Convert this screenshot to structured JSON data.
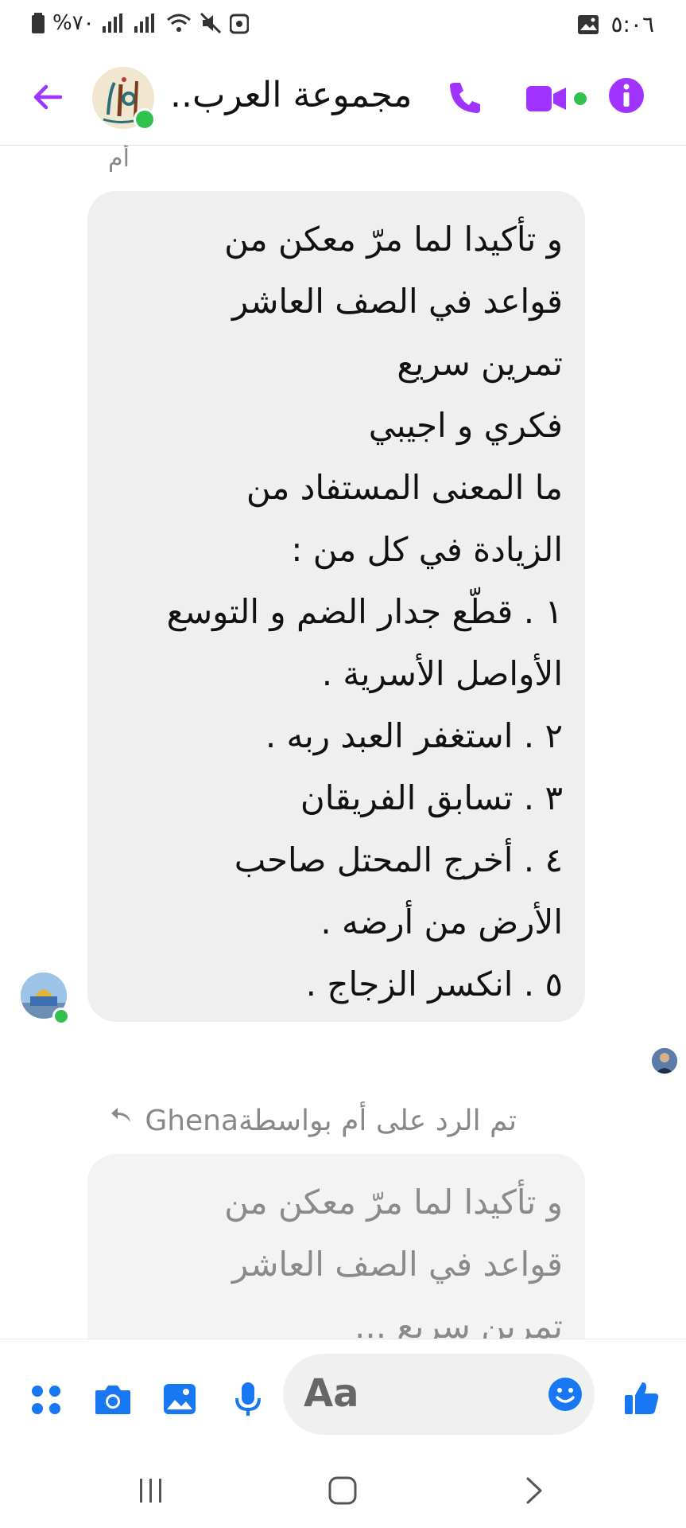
{
  "status_bar": {
    "battery": "%٧٠",
    "time": "٥:٠٦"
  },
  "header": {
    "title": "مجموعة العرب.."
  },
  "messages": [
    {
      "sender_label": "أم",
      "lines": [
        "و تأكيدا لما مرّ معكن من",
        "قواعد في الصف العاشر",
        "تمرين سريع",
        "فكري و اجيبي",
        "ما المعنى المستفاد من",
        "الزيادة في كل من :",
        "١ . قطّع جدار الضم و التوسع",
        "الأواصل الأسرية .",
        "٢ . استغفر العبد ربه .",
        "٣ . تسابق الفريقان",
        "٤ . أخرج المحتل صاحب",
        "الأرض من أرضه .",
        "٥ . انكسر الزجاج ."
      ]
    }
  ],
  "reply": {
    "note": "تم الرد على أم بواسطة",
    "by": "Ghena",
    "preview_lines": [
      "و تأكيدا لما مرّ معكن من",
      "قواعد في الصف العاشر",
      "تمرين سريع ..."
    ]
  },
  "composer": {
    "placeholder": "Aa"
  },
  "colors": {
    "accent": "#a033ff",
    "composer_icon": "#1877f2",
    "online": "#31c24d"
  }
}
